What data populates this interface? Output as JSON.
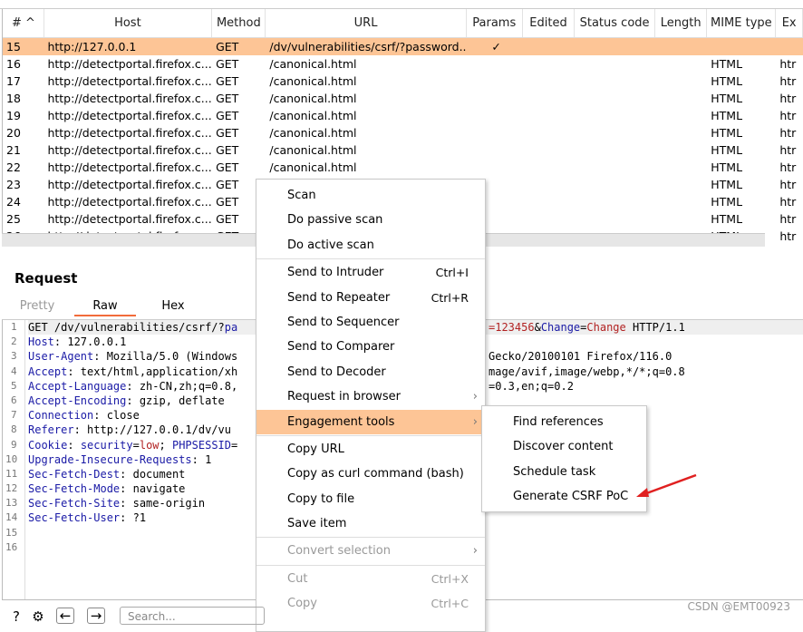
{
  "table": {
    "columns": [
      "#",
      "Host",
      "Method",
      "URL",
      "Params",
      "Edited",
      "Status code",
      "Length",
      "MIME type",
      "Ex"
    ],
    "rows": [
      [
        "15",
        "http://127.0.0.1",
        "GET",
        "/dv/vulnerabilities/csrf/?password...",
        "✓",
        "",
        "",
        "",
        "",
        ""
      ],
      [
        "16",
        "http://detectportal.firefox.c...",
        "GET",
        "/canonical.html",
        "",
        "",
        "",
        "",
        "HTML",
        "htr"
      ],
      [
        "17",
        "http://detectportal.firefox.c...",
        "GET",
        "/canonical.html",
        "",
        "",
        "",
        "",
        "HTML",
        "htr"
      ],
      [
        "18",
        "http://detectportal.firefox.c...",
        "GET",
        "/canonical.html",
        "",
        "",
        "",
        "",
        "HTML",
        "htr"
      ],
      [
        "19",
        "http://detectportal.firefox.c...",
        "GET",
        "/canonical.html",
        "",
        "",
        "",
        "",
        "HTML",
        "htr"
      ],
      [
        "20",
        "http://detectportal.firefox.c...",
        "GET",
        "/canonical.html",
        "",
        "",
        "",
        "",
        "HTML",
        "htr"
      ],
      [
        "21",
        "http://detectportal.firefox.c...",
        "GET",
        "/canonical.html",
        "",
        "",
        "",
        "",
        "HTML",
        "htr"
      ],
      [
        "22",
        "http://detectportal.firefox.c...",
        "GET",
        "/canonical.html",
        "",
        "",
        "",
        "",
        "HTML",
        "htr"
      ],
      [
        "23",
        "http://detectportal.firefox.c...",
        "GET",
        "",
        "",
        "",
        "",
        "",
        "HTML",
        "htr"
      ],
      [
        "24",
        "http://detectportal.firefox.c...",
        "GET",
        "",
        "",
        "",
        "",
        "",
        "HTML",
        "htr"
      ],
      [
        "25",
        "http://detectportal.firefox.c...",
        "GET",
        "",
        "",
        "",
        "",
        "",
        "HTML",
        "htr"
      ],
      [
        "26",
        "http://detectportal.firefox.c...",
        "GET",
        "",
        "",
        "",
        "",
        "",
        "HTML",
        "htr"
      ]
    ],
    "selected_row": "15"
  },
  "request": {
    "title": "Request",
    "tabs": [
      "Pretty",
      "Raw",
      "Hex"
    ],
    "active_tab": "Raw",
    "line_numbers": [
      "1",
      "2",
      "3",
      "4",
      "5",
      "6",
      "7",
      "8",
      "9",
      "10",
      "11",
      "12",
      "13",
      "14",
      "15",
      "16"
    ],
    "lines": [
      {
        "k": "",
        "v": "GET /dv/vulnerabilities/csrf/?",
        "p": "pa",
        "right": "",
        "r": [
          [
            "v",
            "=123456"
          ],
          [
            "",
            "&"
          ],
          [
            "k",
            "Change"
          ],
          [
            "",
            "="
          ],
          [
            "v",
            "Change"
          ],
          [
            "",
            " HTTP/1.1"
          ]
        ]
      },
      {
        "k": "Host",
        "v": ": 127.0.0.1"
      },
      {
        "k": "User-Agent",
        "v": ": Mozilla/5.0 (Windows",
        "right": "Gecko/20100101 Firefox/116.0"
      },
      {
        "k": "Accept",
        "v": ": text/html,application/xh",
        "right": "mage/avif,image/webp,*/*;q=0.8"
      },
      {
        "k": "Accept-Language",
        "v": ": zh-CN,zh;q=0.8,",
        "right": "=0.3,en;q=0.2"
      },
      {
        "k": "Accept-Encoding",
        "v": ": gzip, deflate"
      },
      {
        "k": "Connection",
        "v": ": close"
      },
      {
        "k": "Referer",
        "v": ": http://127.0.0.1/dv/vu"
      },
      {
        "k": "Cookie",
        "v": ": ",
        "cookie": [
          [
            "k",
            "security"
          ],
          [
            "",
            "="
          ],
          [
            "v",
            "low"
          ],
          [
            "",
            "; "
          ],
          [
            "k",
            "PHPSESSID"
          ],
          [
            "",
            "="
          ]
        ]
      },
      {
        "k": "Upgrade-Insecure-Requests",
        "v": ": 1"
      },
      {
        "k": "Sec-Fetch-Dest",
        "v": ": document"
      },
      {
        "k": "Sec-Fetch-Mode",
        "v": ": navigate"
      },
      {
        "k": "Sec-Fetch-Site",
        "v": ": same-origin"
      },
      {
        "k": "Sec-Fetch-User",
        "v": ": ?1"
      }
    ]
  },
  "context_menu": {
    "groups": [
      [
        {
          "label": "Scan"
        },
        {
          "label": "Do passive scan"
        },
        {
          "label": "Do active scan"
        }
      ],
      [
        {
          "label": "Send to Intruder",
          "shortcut": "Ctrl+I"
        },
        {
          "label": "Send to Repeater",
          "shortcut": "Ctrl+R"
        },
        {
          "label": "Send to Sequencer"
        },
        {
          "label": "Send to Comparer"
        },
        {
          "label": "Send to Decoder"
        },
        {
          "label": "Request in browser",
          "submenu": true
        },
        {
          "label": "Engagement tools",
          "submenu": true,
          "highlighted": true
        }
      ],
      [
        {
          "label": "Copy URL"
        },
        {
          "label": "Copy as curl command (bash)"
        },
        {
          "label": "Copy to file"
        },
        {
          "label": "Save item"
        }
      ],
      [
        {
          "label": "Convert selection",
          "submenu": true,
          "disabled": true
        }
      ],
      [
        {
          "label": "Cut",
          "shortcut": "Ctrl+X",
          "disabled": true
        },
        {
          "label": "Copy",
          "shortcut": "Ctrl+C",
          "disabled": true
        }
      ]
    ]
  },
  "submenu": {
    "items": [
      "Find references",
      "Discover content",
      "Schedule task",
      "Generate CSRF PoC"
    ]
  },
  "bottom": {
    "search_placeholder": "Search..."
  },
  "watermark": "CSDN @EMT00923",
  "colors": {
    "highlight": "#fdc596",
    "accent_tab": "#f26b3a",
    "header_key": "#1a1aa6",
    "value_red": "#b22222",
    "arrow": "#e02020"
  }
}
